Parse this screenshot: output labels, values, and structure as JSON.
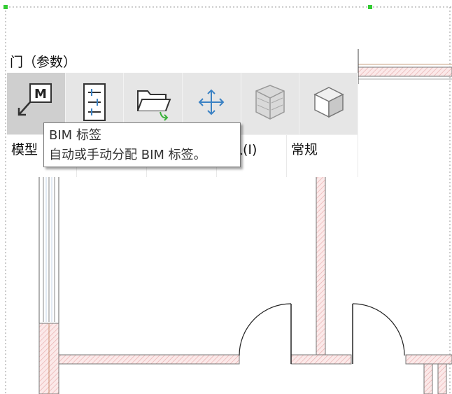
{
  "panel": {
    "title": "门（参数）"
  },
  "ribbon": {
    "buttons": [
      {
        "label": "模型",
        "icon": "model-m-icon"
      },
      {
        "label": "",
        "icon": "bim-tags-icon"
      },
      {
        "label": "",
        "icon": "load-family-icon"
      },
      {
        "label": "入(I)",
        "icon": "move-arrows-icon"
      },
      {
        "label": "常规",
        "icon": "wall-icon"
      },
      {
        "label": "",
        "icon": "cube-icon"
      }
    ]
  },
  "tooltip": {
    "title": "BIM 标签",
    "description": "自动或手动分配 BIM 标签。"
  },
  "colors": {
    "ribbon_bg": "#e6e6e6",
    "wall_hatch": "#f2b8b8",
    "selection_grip": "#33cc33",
    "move_icon": "#3b82c4"
  }
}
